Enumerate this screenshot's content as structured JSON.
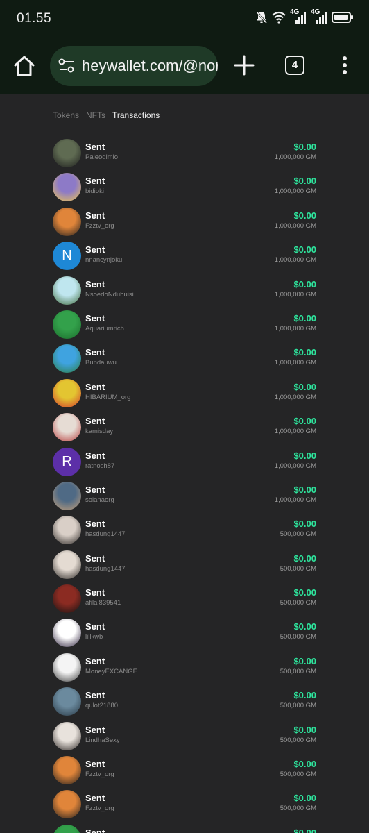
{
  "status_bar": {
    "time": "01.55",
    "signal_1": "4G",
    "signal_2": "4G",
    "icons": [
      "mute-bell-icon",
      "wifi-icon",
      "signal-icon",
      "signal-icon",
      "battery-icon"
    ]
  },
  "browser": {
    "url": "heywallet.com/@nor",
    "tab_count": "4",
    "icons": [
      "home-icon",
      "site-settings-icon",
      "plus-icon",
      "tab-switcher-icon",
      "more-vert-icon"
    ]
  },
  "tabs": [
    {
      "label": "Tokens",
      "active": false
    },
    {
      "label": "NFTs",
      "active": false
    },
    {
      "label": "Transactions",
      "active": true
    }
  ],
  "transactions": [
    {
      "title": "Sent",
      "user": "Paleodimio",
      "amount": "$0.00",
      "gm": "1,000,000 GM",
      "avatar_colors": [
        "#5f6b52",
        "#1b1b1b"
      ],
      "letter": ""
    },
    {
      "title": "Sent",
      "user": "bidioki",
      "amount": "$0.00",
      "gm": "1,000,000 GM",
      "avatar_colors": [
        "#8d7ac7",
        "#f1c94b"
      ],
      "letter": ""
    },
    {
      "title": "Sent",
      "user": "Fzztv_org",
      "amount": "$0.00",
      "gm": "1,000,000 GM",
      "avatar_colors": [
        "#e0853a",
        "#1d1d1d"
      ],
      "letter": ""
    },
    {
      "title": "Sent",
      "user": "nnancynjoku",
      "amount": "$0.00",
      "gm": "1,000,000 GM",
      "avatar_colors": [
        "#1e88d6",
        "#1e88d6"
      ],
      "letter": "N"
    },
    {
      "title": "Sent",
      "user": "NsoedoNdubuisi",
      "amount": "$0.00",
      "gm": "1,000,000 GM",
      "avatar_colors": [
        "#bfe6ef",
        "#3e6b3a"
      ],
      "letter": ""
    },
    {
      "title": "Sent",
      "user": "Aquariumrich",
      "amount": "$0.00",
      "gm": "1,000,000 GM",
      "avatar_colors": [
        "#33a14b",
        "#1a6b2b"
      ],
      "letter": ""
    },
    {
      "title": "Sent",
      "user": "Bundauwu",
      "amount": "$0.00",
      "gm": "1,000,000 GM",
      "avatar_colors": [
        "#3fa3e0",
        "#2b7d3f"
      ],
      "letter": ""
    },
    {
      "title": "Sent",
      "user": "HIBARIUM_org",
      "amount": "$0.00",
      "gm": "1,000,000 GM",
      "avatar_colors": [
        "#e3c531",
        "#d0352b"
      ],
      "letter": ""
    },
    {
      "title": "Sent",
      "user": "kamisday",
      "amount": "$0.00",
      "gm": "1,000,000 GM",
      "avatar_colors": [
        "#e6dcd4",
        "#b83b3b"
      ],
      "letter": ""
    },
    {
      "title": "Sent",
      "user": "ratnosh87",
      "amount": "$0.00",
      "gm": "1,000,000 GM",
      "avatar_colors": [
        "#5c2fa8",
        "#5c2fa8"
      ],
      "letter": "R"
    },
    {
      "title": "Sent",
      "user": "solanaorg",
      "amount": "$0.00",
      "gm": "1,000,000 GM",
      "avatar_colors": [
        "#4f6a85",
        "#c9a27a"
      ],
      "letter": ""
    },
    {
      "title": "Sent",
      "user": "hasdung1447",
      "amount": "$0.00",
      "gm": "500,000 GM",
      "avatar_colors": [
        "#d9cfc7",
        "#2a2623"
      ],
      "letter": ""
    },
    {
      "title": "Sent",
      "user": "hasdung1447",
      "amount": "$0.00",
      "gm": "500,000 GM",
      "avatar_colors": [
        "#e4dbd2",
        "#2a2623"
      ],
      "letter": ""
    },
    {
      "title": "Sent",
      "user": "afilal839541",
      "amount": "$0.00",
      "gm": "500,000 GM",
      "avatar_colors": [
        "#8b2b22",
        "#121212"
      ],
      "letter": ""
    },
    {
      "title": "Sent",
      "user": "lillkwb",
      "amount": "$0.00",
      "gm": "500,000 GM",
      "avatar_colors": [
        "#ffffff",
        "#2b1f3a"
      ],
      "letter": ""
    },
    {
      "title": "Sent",
      "user": "MoneyEXCANGE",
      "amount": "$0.00",
      "gm": "500,000 GM",
      "avatar_colors": [
        "#f4f4f4",
        "#3a3a3a"
      ],
      "letter": ""
    },
    {
      "title": "Sent",
      "user": "qulot21880",
      "amount": "$0.00",
      "gm": "500,000 GM",
      "avatar_colors": [
        "#6b8a9e",
        "#263642"
      ],
      "letter": ""
    },
    {
      "title": "Sent",
      "user": "LindhaSexy",
      "amount": "$0.00",
      "gm": "500,000 GM",
      "avatar_colors": [
        "#e8e2dc",
        "#2b2523"
      ],
      "letter": ""
    },
    {
      "title": "Sent",
      "user": "Fzztv_org",
      "amount": "$0.00",
      "gm": "500,000 GM",
      "avatar_colors": [
        "#e0853a",
        "#1d1d1d"
      ],
      "letter": ""
    },
    {
      "title": "Sent",
      "user": "Fzztv_org",
      "amount": "$0.00",
      "gm": "500,000 GM",
      "avatar_colors": [
        "#e0853a",
        "#1d1d1d"
      ],
      "letter": ""
    },
    {
      "title": "Sent",
      "user": "",
      "amount": "$0.00",
      "gm": "",
      "avatar_colors": [
        "#33a14b",
        "#1a6b2b"
      ],
      "letter": ""
    }
  ],
  "colors": {
    "background": "#252526",
    "browser_bar": "#0f1b12",
    "url_pill": "#1f3a27",
    "accent_green": "#2ee59d"
  }
}
